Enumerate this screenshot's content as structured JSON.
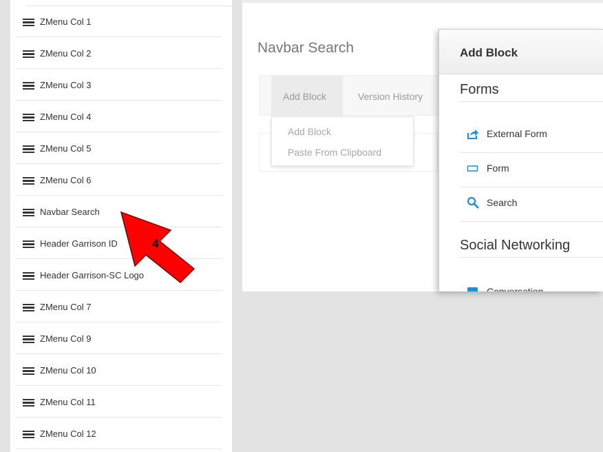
{
  "block_list": {
    "items": [
      {
        "label": "ZMenu Col 1"
      },
      {
        "label": "ZMenu Col 2"
      },
      {
        "label": "ZMenu Col 3"
      },
      {
        "label": "ZMenu Col 4"
      },
      {
        "label": "ZMenu Col 5"
      },
      {
        "label": "ZMenu Col 6"
      },
      {
        "label": "Navbar Search"
      },
      {
        "label": "Header Garrison ID"
      },
      {
        "label": "Header Garrison-SC Logo"
      },
      {
        "label": "ZMenu Col 7"
      },
      {
        "label": "ZMenu Col 9"
      },
      {
        "label": "ZMenu Col 10"
      },
      {
        "label": "ZMenu Col 11"
      },
      {
        "label": "ZMenu Col 12"
      }
    ],
    "item_icon": "hamburger-icon"
  },
  "content": {
    "title": "Navbar Search",
    "tabs": [
      {
        "label": "Add Block"
      },
      {
        "label": "Version History"
      }
    ],
    "dropdown": {
      "items": [
        {
          "label": "Add Block"
        },
        {
          "label": "Paste From Clipboard"
        }
      ]
    }
  },
  "modal": {
    "title": "Add Block",
    "sections": [
      {
        "title": "Forms",
        "items": [
          {
            "label": "External Form",
            "icon": "external-form-icon"
          },
          {
            "label": "Form",
            "icon": "form-icon"
          },
          {
            "label": "Search",
            "icon": "search-icon"
          }
        ]
      },
      {
        "title": "Social Networking",
        "items": [
          {
            "label": "Conversation",
            "icon": "conversation-icon"
          }
        ]
      }
    ]
  },
  "annotation": {
    "step_number": "4",
    "arrow_color": "#ff0000"
  },
  "colors": {
    "icon_blue": "#1e8fd6",
    "muted_text": "#999999"
  }
}
